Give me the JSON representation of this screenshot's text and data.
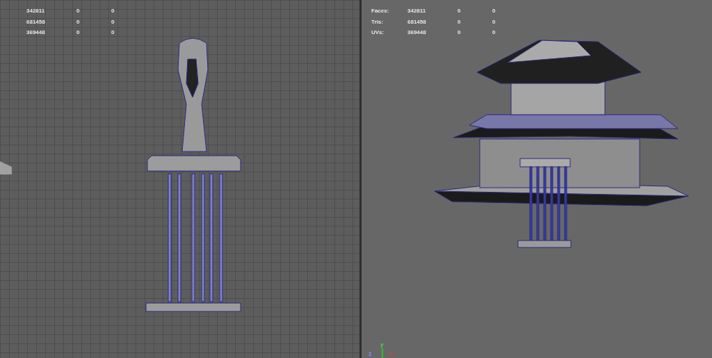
{
  "left_viewport": {
    "stats": [
      {
        "value": "342811",
        "col_2": "0",
        "col_3": "0"
      },
      {
        "value": "681458",
        "col_2": "0",
        "col_3": "0"
      },
      {
        "value": "369448",
        "col_2": "0",
        "col_3": "0"
      }
    ]
  },
  "right_viewport": {
    "stats": [
      {
        "label": "Faces:",
        "value": "342811",
        "col_2": "0",
        "col_3": "0"
      },
      {
        "label": "Tris:",
        "value": "681458",
        "col_2": "0",
        "col_3": "0"
      },
      {
        "label": "UVs:",
        "value": "369448",
        "col_2": "0",
        "col_3": "0"
      }
    ],
    "axis": {
      "y_label": "y",
      "x_label": "x",
      "z_label": "z"
    }
  }
}
